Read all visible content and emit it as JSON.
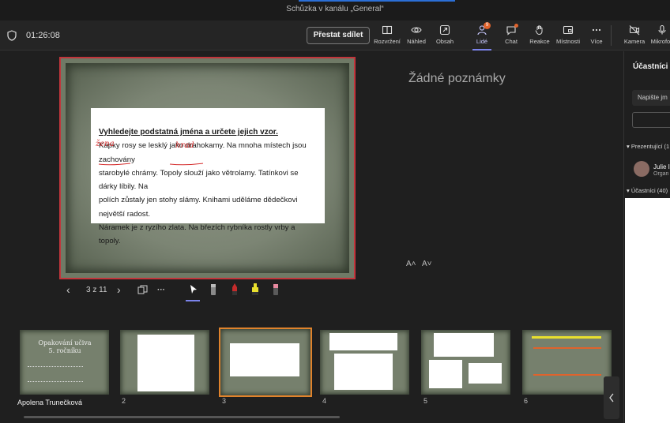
{
  "window": {
    "title": "Schůzka v kanálu „General“"
  },
  "meeting": {
    "elapsed": "01:26:08",
    "stop_sharing": "Přestat sdílet"
  },
  "toolbar": {
    "items": [
      {
        "label": "Rozvržení",
        "icon": "layout-icon"
      },
      {
        "label": "Náhled",
        "icon": "eye-icon"
      },
      {
        "label": "Obsah",
        "icon": "share-content-icon"
      },
      {
        "label": "Lidé",
        "icon": "people-icon",
        "badge": "9"
      },
      {
        "label": "Chat",
        "icon": "chat-icon"
      },
      {
        "label": "Reakce",
        "icon": "reaction-icon"
      },
      {
        "label": "Místnosti",
        "icon": "rooms-icon"
      },
      {
        "label": "Více",
        "icon": "more-icon"
      },
      {
        "label": "Kamera",
        "icon": "camera-off-icon"
      },
      {
        "label": "Mikrofon",
        "icon": "mic-icon"
      }
    ]
  },
  "slide": {
    "heading": "Vyhledejte podstatná jména a určete jejich vzor.",
    "line1": "Kapky rosy se lesklý jako drahokamy. Na mnoha místech jsou zachovány",
    "line2": "starobylé chrámy. Topoly slouží jako větrolamy. Tatínkovi se dárky líbily. Na",
    "line3": "polích zůstaly jen stohy slámy. Knihami uděláme dědečkovi největší radost.",
    "line4": "Náramek je z ryzího zlata. Na březích rybníka rostly vrby a topoly.",
    "handwriting_1": "žena",
    "handwriting_2": "hrad"
  },
  "notes": {
    "text": "Žádné poznámky"
  },
  "font_controls": {
    "increase": "A˄",
    "decrease": "A˅"
  },
  "navigator": {
    "page": "3 z 11",
    "prev": "‹",
    "next": "›",
    "more": "···"
  },
  "thumbnails": [
    {
      "num": "",
      "title": "Opakování učiva 5. ročníku"
    },
    {
      "num": "2"
    },
    {
      "num": "3"
    },
    {
      "num": "4"
    },
    {
      "num": "5"
    },
    {
      "num": "6"
    }
  ],
  "presenter": {
    "name": "Apolena Trunečková"
  },
  "panel": {
    "title": "Účastníci",
    "invite_placeholder": "Napište jm",
    "presenters_label": "Prezentující (1",
    "presenter_name": "Julie I",
    "presenter_role": "Organ",
    "attendees_label": "Účastníci (40)"
  },
  "colors": {
    "accent": "#7b83eb",
    "slide_border": "#c2353b",
    "selected_thumb": "#e0832c",
    "badge": "#e0632c"
  }
}
